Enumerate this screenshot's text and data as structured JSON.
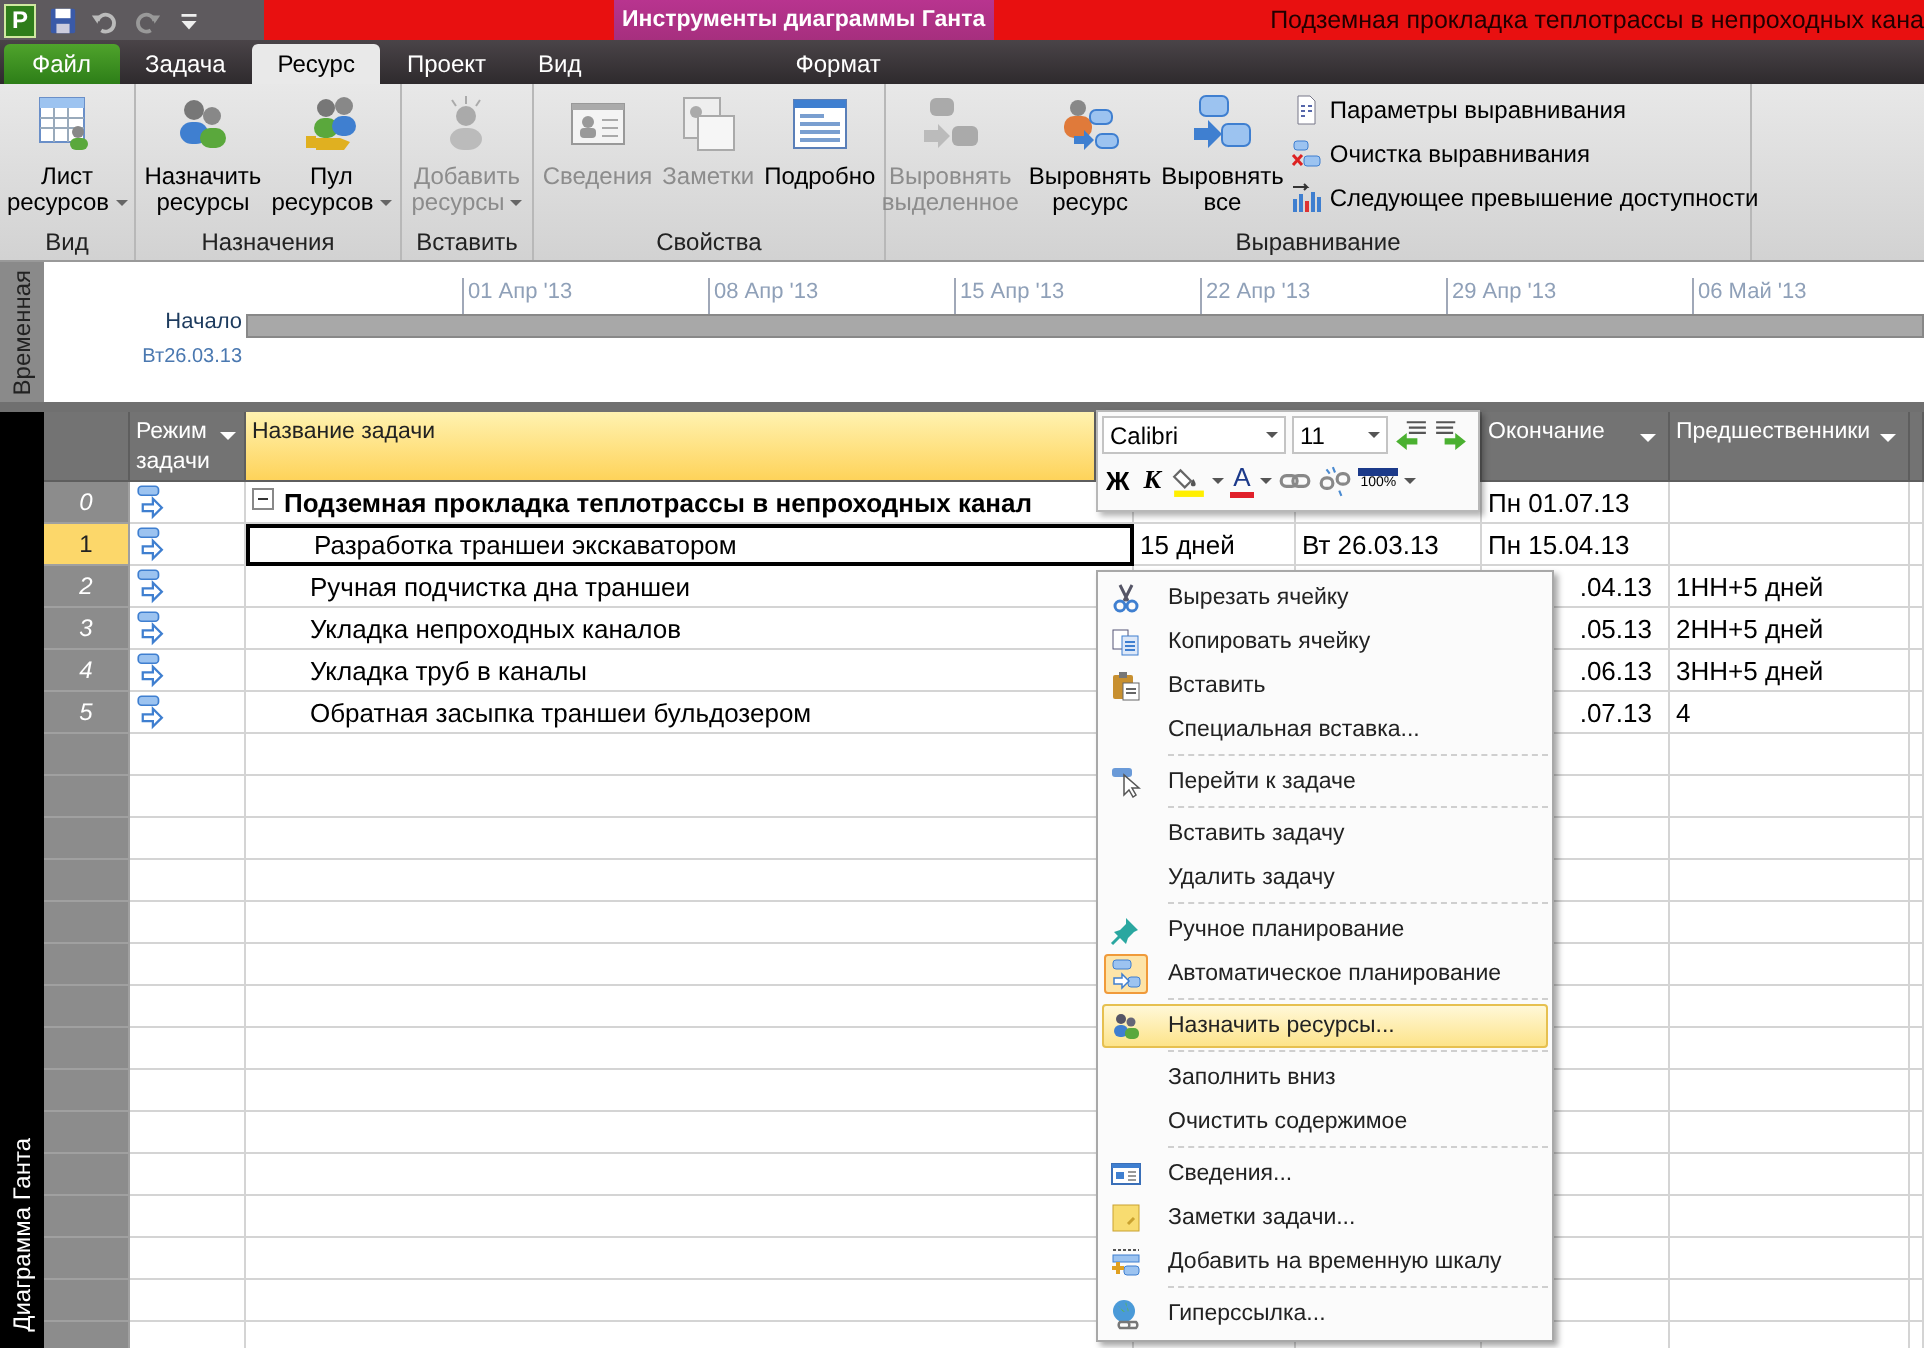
{
  "title_bar": {
    "app_letter": "P",
    "context_header": "Инструменты диаграммы Ганта",
    "title": "Подземная прокладка теплотрассы в непроходных кана"
  },
  "tabs": [
    {
      "label": "Файл",
      "kind": "file",
      "selected": false
    },
    {
      "label": "Задача",
      "kind": "normal",
      "selected": false
    },
    {
      "label": "Ресурс",
      "kind": "normal",
      "selected": true
    },
    {
      "label": "Проект",
      "kind": "normal",
      "selected": false
    },
    {
      "label": "Вид",
      "kind": "normal",
      "selected": false
    },
    {
      "label": "Формат",
      "kind": "context",
      "selected": false
    }
  ],
  "ribbon_groups": [
    {
      "label": "Вид",
      "commands": [
        {
          "lines": [
            "Лист",
            "ресурсов"
          ],
          "kind": "large",
          "disabled": false,
          "dropdown": true
        }
      ]
    },
    {
      "label": "Назначения",
      "commands": [
        {
          "lines": [
            "Назначить",
            "ресурсы"
          ],
          "kind": "large",
          "disabled": false,
          "dropdown": false
        },
        {
          "lines": [
            "Пул",
            "ресурсов"
          ],
          "kind": "large",
          "disabled": false,
          "dropdown": true
        }
      ]
    },
    {
      "label": "Вставить",
      "commands": [
        {
          "lines": [
            "Добавить",
            "ресурсы"
          ],
          "kind": "large",
          "disabled": true,
          "dropdown": true
        }
      ]
    },
    {
      "label": "Свойства",
      "commands": [
        {
          "lines": [
            "Сведения"
          ],
          "kind": "large",
          "disabled": true,
          "dropdown": false
        },
        {
          "lines": [
            "Заметки"
          ],
          "kind": "large",
          "disabled": true,
          "dropdown": false
        },
        {
          "lines": [
            "Подробно"
          ],
          "kind": "large",
          "disabled": false,
          "dropdown": false
        }
      ]
    },
    {
      "label": "Выравнивание",
      "commands": [
        {
          "lines": [
            "Выровнять",
            "выделенное"
          ],
          "kind": "large",
          "disabled": true,
          "dropdown": false
        },
        {
          "lines": [
            "Выровнять",
            "ресурс"
          ],
          "kind": "large",
          "disabled": false,
          "dropdown": false
        },
        {
          "lines": [
            "Выровнять",
            "все"
          ],
          "kind": "large",
          "disabled": false,
          "dropdown": false
        },
        {
          "lines": [
            "Параметры выравнивания"
          ],
          "kind": "small",
          "disabled": false
        },
        {
          "lines": [
            "Очистка выравнивания"
          ],
          "kind": "small",
          "disabled": false
        },
        {
          "lines": [
            "Следующее превышение доступности"
          ],
          "kind": "small",
          "disabled": false
        }
      ]
    }
  ],
  "timeline": {
    "side_label": "Временная",
    "start_label": "Начало",
    "start_date": "Вт26.03.13",
    "ticks": [
      "01 Апр '13",
      "08 Апр '13",
      "15 Апр '13",
      "22 Апр '13",
      "29 Апр '13",
      "06 Май '13"
    ]
  },
  "grid": {
    "side_label": "Диаграмма Ганта",
    "columns": [
      {
        "kind": "number"
      },
      {
        "kind": "mode",
        "label": "Режим задачи",
        "selected": false
      },
      {
        "kind": "name",
        "label": "Название задачи",
        "selected": true
      },
      {
        "kind": "duration"
      },
      {
        "kind": "start"
      },
      {
        "kind": "finish",
        "label": "Окончание",
        "selected": false
      },
      {
        "kind": "predecessors",
        "label": "Предшественники",
        "selected": false
      },
      {
        "kind": "extra"
      }
    ],
    "rows": [
      {
        "number": "0",
        "name": "Подземная прокладка теплотрассы в непроходных канал",
        "summary": true,
        "selected": false,
        "finish": "Пн 01.07.13",
        "finish_covered": false
      },
      {
        "number": "1",
        "name": "Разработка траншеи экскаватором",
        "summary": false,
        "selected": true,
        "duration": "15 дней",
        "start": "Вт 26.03.13",
        "finish": "Пн 15.04.13",
        "finish_covered": false
      },
      {
        "number": "2",
        "name": "Ручная подчистка дна траншеи",
        "summary": false,
        "selected": false,
        "finish": ".04.13",
        "finish_covered": true,
        "predecessors": "1НН+5 дней"
      },
      {
        "number": "3",
        "name": "Укладка непроходных каналов",
        "summary": false,
        "selected": false,
        "finish": ".05.13",
        "finish_covered": true,
        "predecessors": "2НН+5 дней"
      },
      {
        "number": "4",
        "name": "Укладка труб в каналы",
        "summary": false,
        "selected": false,
        "finish": ".06.13",
        "finish_covered": true,
        "predecessors": "3НН+5 дней"
      },
      {
        "number": "5",
        "name": "Обратная засыпка траншеи бульдозером",
        "summary": false,
        "selected": false,
        "finish": ".07.13",
        "finish_covered": true,
        "predecessors": "4"
      }
    ]
  },
  "mini_toolbar": {
    "font": "Calibri",
    "size": "11",
    "bold": "Ж",
    "italic": "К",
    "font_color": "А",
    "progress_label": "100%"
  },
  "context_menu": [
    {
      "label": "Вырезать ячейку",
      "separator_before": false,
      "checked": false,
      "selected": false
    },
    {
      "label": "Копировать ячейку",
      "separator_before": false,
      "checked": false,
      "selected": false
    },
    {
      "label": "Вставить",
      "separator_before": false,
      "checked": false,
      "selected": false
    },
    {
      "label": "Специальная вставка...",
      "separator_before": false,
      "checked": false,
      "selected": false
    },
    {
      "label": "Перейти к задаче",
      "separator_before": true,
      "checked": false,
      "selected": false
    },
    {
      "label": "Вставить задачу",
      "separator_before": true,
      "checked": false,
      "selected": false
    },
    {
      "label": "Удалить задачу",
      "separator_before": false,
      "checked": false,
      "selected": false
    },
    {
      "label": "Ручное планирование",
      "separator_before": true,
      "checked": false,
      "selected": false
    },
    {
      "label": "Автоматическое планирование",
      "separator_before": false,
      "checked": true,
      "selected": false
    },
    {
      "label": "Назначить ресурсы...",
      "separator_before": true,
      "checked": false,
      "selected": true
    },
    {
      "label": "Заполнить вниз",
      "separator_before": true,
      "checked": false,
      "selected": false
    },
    {
      "label": "Очистить содержимое",
      "separator_before": false,
      "checked": false,
      "selected": false
    },
    {
      "label": "Сведения...",
      "separator_before": true,
      "checked": false,
      "selected": false
    },
    {
      "label": "Заметки задачи...",
      "separator_before": false,
      "checked": false,
      "selected": false
    },
    {
      "label": "Добавить на временную шкалу",
      "separator_before": false,
      "checked": false,
      "selected": false
    },
    {
      "label": "Гиперссылка...",
      "separator_before": true,
      "checked": false,
      "selected": false
    }
  ]
}
